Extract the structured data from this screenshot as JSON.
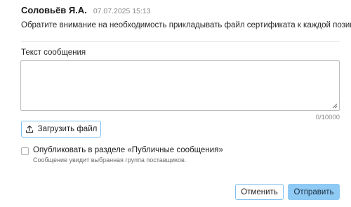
{
  "comment": {
    "author": "Соловьёв Я.А.",
    "timestamp": "07.07.2025 15:13",
    "message": "Обратите внимание на необходимость прикладывать файл сертификата к каждой позиции."
  },
  "reply_form": {
    "text_label": "Текст сообщения",
    "text_value": "",
    "char_counter": "0/10000",
    "upload_button_label": "Загрузить файл",
    "upload_icon": "upload-icon",
    "publish_checkbox": {
      "checked": false,
      "label": "Опубликовать в разделе «Публичные сообщения»",
      "hint": "Сообщение увидит выбранная группа поставщиков."
    },
    "cancel_label": "Отменить",
    "submit_label": "Отправить"
  },
  "colors": {
    "accent_border": "#7fc0f0",
    "primary_button": "#8fcaf5",
    "muted_text": "#8a8a8a"
  }
}
